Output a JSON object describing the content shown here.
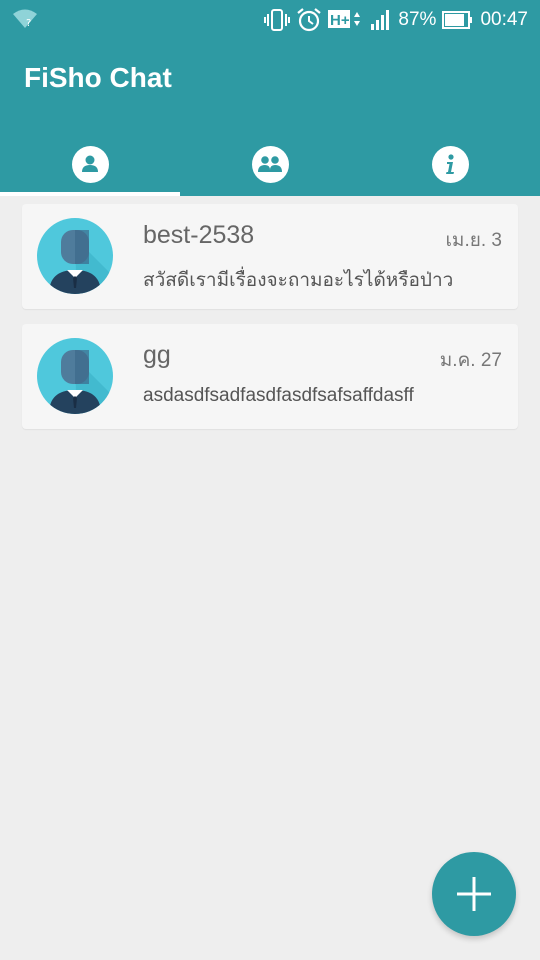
{
  "status_bar": {
    "battery_text": "87%",
    "time": "00:47",
    "network_label": "H+",
    "icons": [
      "wifi-question-icon",
      "vibrate-icon",
      "alarm-icon",
      "network-h-plus-icon",
      "signal-icon",
      "battery-icon"
    ]
  },
  "app": {
    "title": "FiSho Chat",
    "accent_color": "#2e9aa3"
  },
  "tabs": [
    {
      "icon": "person-icon",
      "selected": true
    },
    {
      "icon": "group-icon",
      "selected": false
    },
    {
      "icon": "info-icon",
      "selected": false
    }
  ],
  "chats": [
    {
      "name": "best-2538",
      "date": "เม.ย. 3",
      "message": "สวัสดีเรามีเรื่องจะถามอะไรได้หรือป่าว",
      "avatar_icon": "user-avatar-icon"
    },
    {
      "name": "gg",
      "date": "ม.ค. 27",
      "message": "asdasdfsadfasdfasdfsafsaffdasff",
      "avatar_icon": "user-avatar-icon"
    }
  ],
  "fab": {
    "icon": "plus-icon"
  }
}
